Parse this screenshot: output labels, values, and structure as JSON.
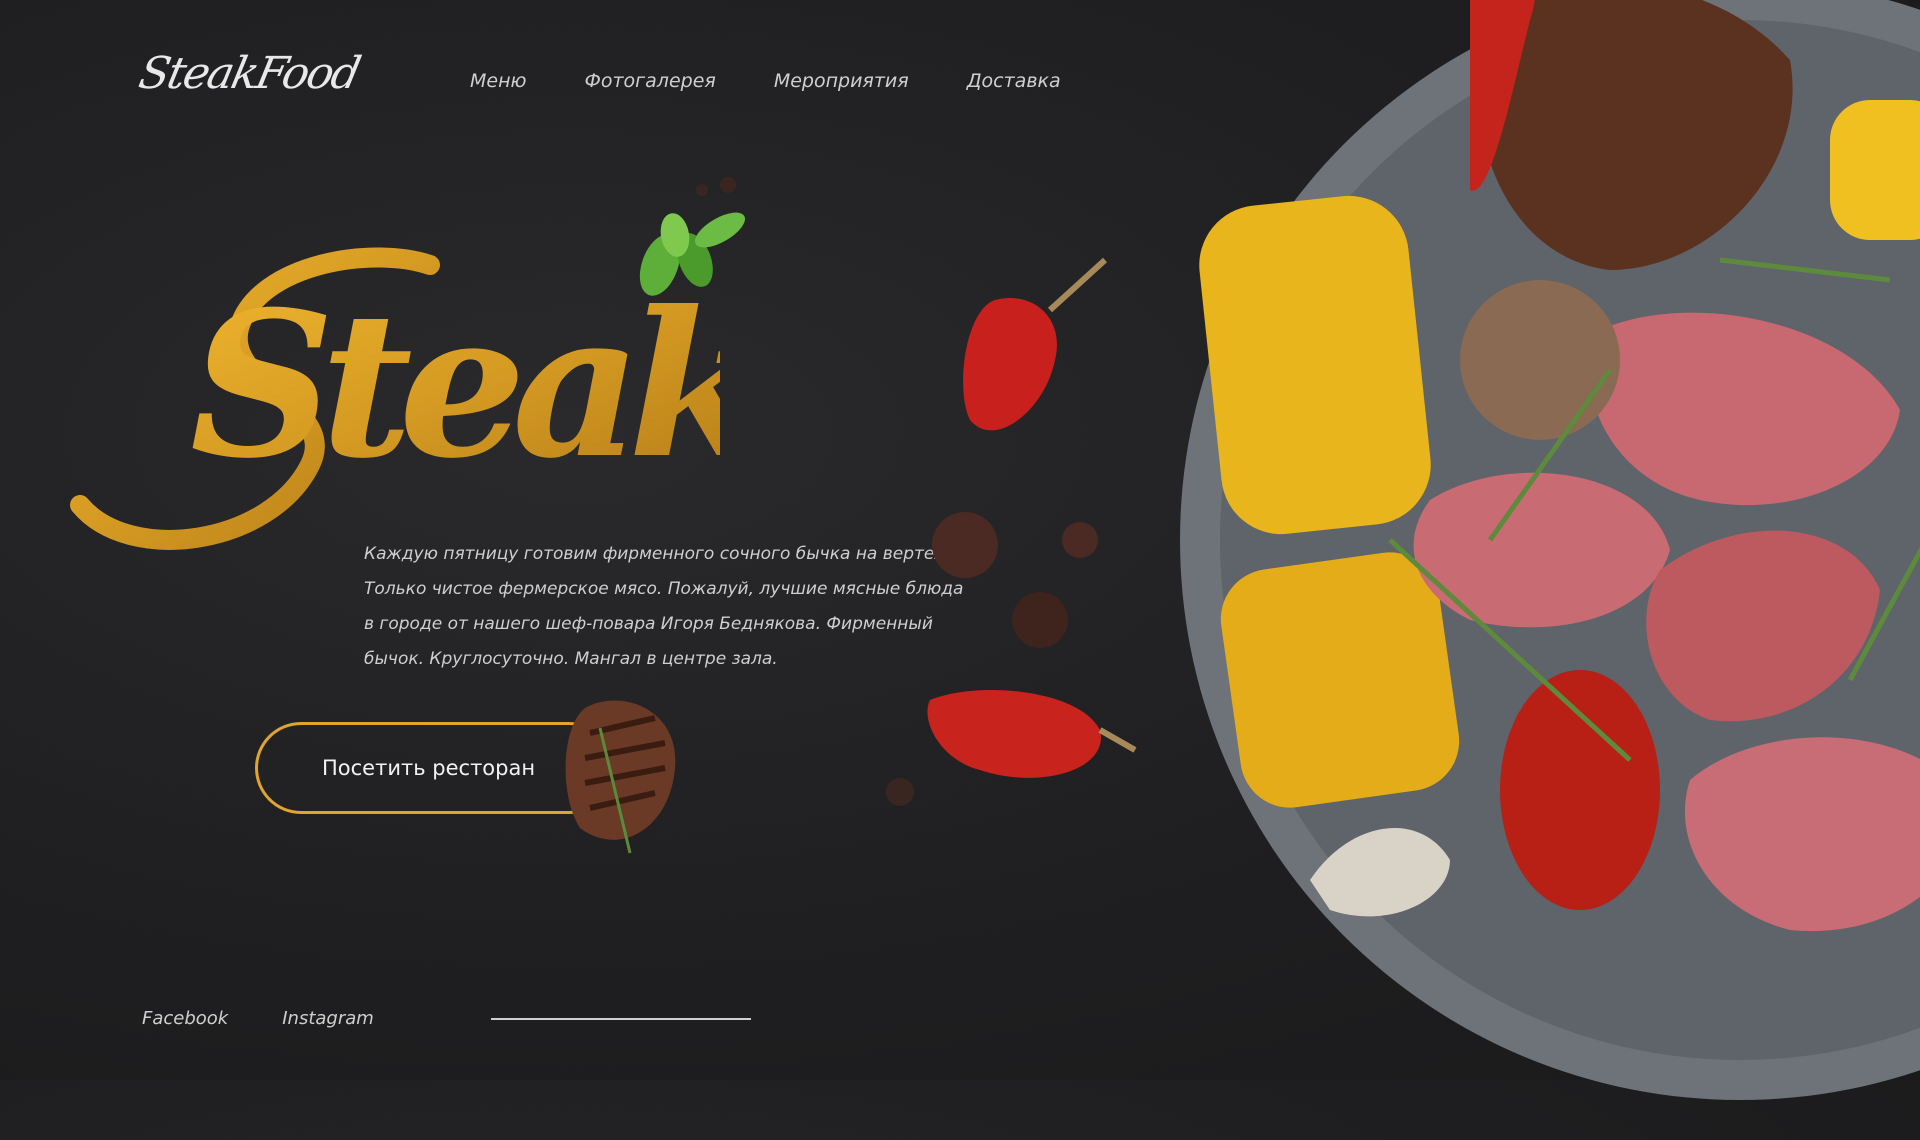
{
  "brand": {
    "logo_text": "SteakFood"
  },
  "nav": {
    "items": [
      {
        "label": "Меню"
      },
      {
        "label": "Фотогалерея"
      },
      {
        "label": "Мероприятия"
      },
      {
        "label": "Доставка"
      }
    ]
  },
  "hero": {
    "title": "Steak",
    "description": "Каждую пятницу готовим фирменного сочного бычка на вертеле. Только чистое фермерское мясо. Пожалуй, лучшие мясные блюда в городе от нашего шеф-повара Игоря Беднякова. Фирменный бычок. Круглосуточно. Мангал в центре зала.",
    "cta_label": "Посетить ресторан"
  },
  "footer": {
    "links": [
      {
        "label": "Facebook"
      },
      {
        "label": "Instagram"
      }
    ]
  },
  "colors": {
    "background": "#1f1f21",
    "accent_gold": "#e0a52a",
    "text": "#cfcfcf",
    "plate": "#6e7279"
  },
  "icons": [
    "basil-leaf-icon",
    "chili-pepper-icon",
    "peppercorn-icon",
    "steak-icon"
  ]
}
